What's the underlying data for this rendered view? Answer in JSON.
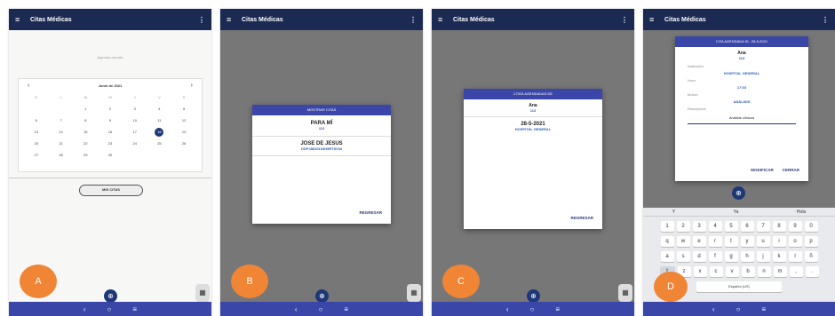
{
  "app": {
    "title": "Citas Médicas",
    "menu_icon": "≡",
    "more_icon": "⋮"
  },
  "nav": {
    "back": "‹",
    "home": "○",
    "recent": "≡"
  },
  "fab_icon": "⊕",
  "qr_icon": "▦",
  "panel_a": {
    "label": "A",
    "hint": "Agenda una cita",
    "calendar": {
      "month": "Junio de 2021",
      "prev": "‹",
      "next": "›",
      "weekdays": [
        "D",
        "L",
        "M",
        "M",
        "J",
        "V",
        "S"
      ],
      "selected_day": "18"
    },
    "button": "MIS CITAS"
  },
  "panel_b": {
    "label": "B",
    "dialog_title": "MOSTRAR CITAS",
    "entries": [
      {
        "name": "PARA MÍ",
        "sub": "113"
      },
      {
        "name": "JOSE DE JESUS",
        "sub": "DDPJ8810193H5RTS034"
      }
    ],
    "action": "REGRESAR"
  },
  "panel_c": {
    "label": "C",
    "dialog_title": "CITAS AGENDADAS DE",
    "person": "Ana",
    "person_sub": "113",
    "date": "28-5-2021",
    "institution": "HOSPITAL GENERAL",
    "action": "REGRESAR"
  },
  "panel_d": {
    "label": "D",
    "dialog_title": "CITA AGENDADA EL: 28-5-2021",
    "person": "Ana",
    "person_sub": "113",
    "institution_label": "Institución",
    "institution": "HOSPITAL GENERAL",
    "time_label": "Hora",
    "time": "17:03",
    "reason_label": "Motivo",
    "reason": "ANÁLISIS",
    "desc_label": "Descripción",
    "desc": "Análisis clínicos",
    "action_modify": "MODIFICAR",
    "action_close": "CERRAR",
    "keyboard": {
      "suggestions": [
        "Y",
        "Ya",
        "Hola"
      ],
      "row1": [
        "1",
        "2",
        "3",
        "4",
        "5",
        "6",
        "7",
        "8",
        "9",
        "0"
      ],
      "row2": [
        "q",
        "w",
        "e",
        "r",
        "t",
        "y",
        "u",
        "i",
        "o",
        "p"
      ],
      "row3": [
        "a",
        "s",
        "d",
        "f",
        "g",
        "h",
        "j",
        "k",
        "l",
        "ñ"
      ],
      "row4": [
        "⇧",
        "z",
        "x",
        "c",
        "v",
        "b",
        "n",
        "m",
        ",",
        "."
      ],
      "space": "Español (US)"
    }
  }
}
